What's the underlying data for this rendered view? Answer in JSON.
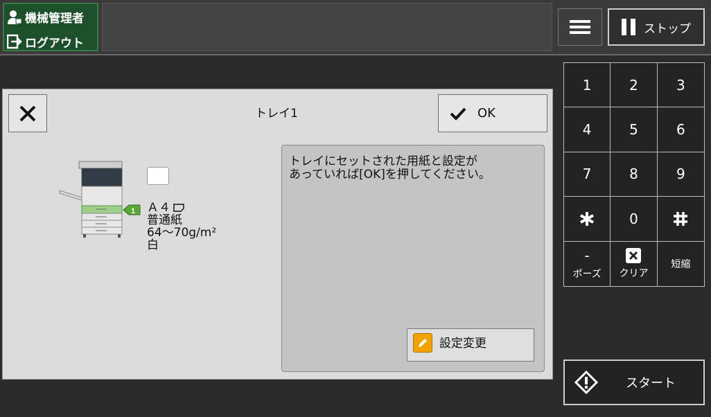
{
  "header": {
    "user_label": "機械管理者",
    "logout_label": "ログアウト",
    "user_icon": "user-icon",
    "logout_icon": "logout-icon",
    "menu_icon": "hamburger-icon",
    "stop_label": "ストップ",
    "stop_icon": "pause-icon"
  },
  "dialog": {
    "title": "トレイ1",
    "close_icon": "close-icon",
    "ok_label": "OK",
    "ok_icon": "checkmark-icon",
    "tray_number": "1",
    "paper_size": "Ａ４",
    "paper_type": "普通紙",
    "paper_weight": "64～70g/m²",
    "paper_color": "白",
    "message_line1": "トレイにセットされた用紙と設定が",
    "message_line2": "あっていれば[OK]を押してください。",
    "change_label": "設定変更",
    "change_icon": "pencil-icon"
  },
  "keypad": {
    "keys": [
      "1",
      "2",
      "3",
      "4",
      "5",
      "6",
      "7",
      "8",
      "9"
    ],
    "asterisk_icon": "asterisk-icon",
    "zero": "0",
    "hash_icon": "hash-icon",
    "pause_symbol": "-",
    "pause_label": "ポーズ",
    "clear_label": "クリア",
    "clear_icon": "clear-x-icon",
    "short_label": "短縮"
  },
  "start": {
    "label": "スタート",
    "icon": "start-diamond-icon"
  },
  "colors": {
    "user_box": "#1d4f2a",
    "tray_highlight": "#9fd08a",
    "tray_badge": "#5aa832",
    "pencil_icon": "#f2a300",
    "background": "#2b2b2b",
    "dialog": "#dcdcdc"
  }
}
